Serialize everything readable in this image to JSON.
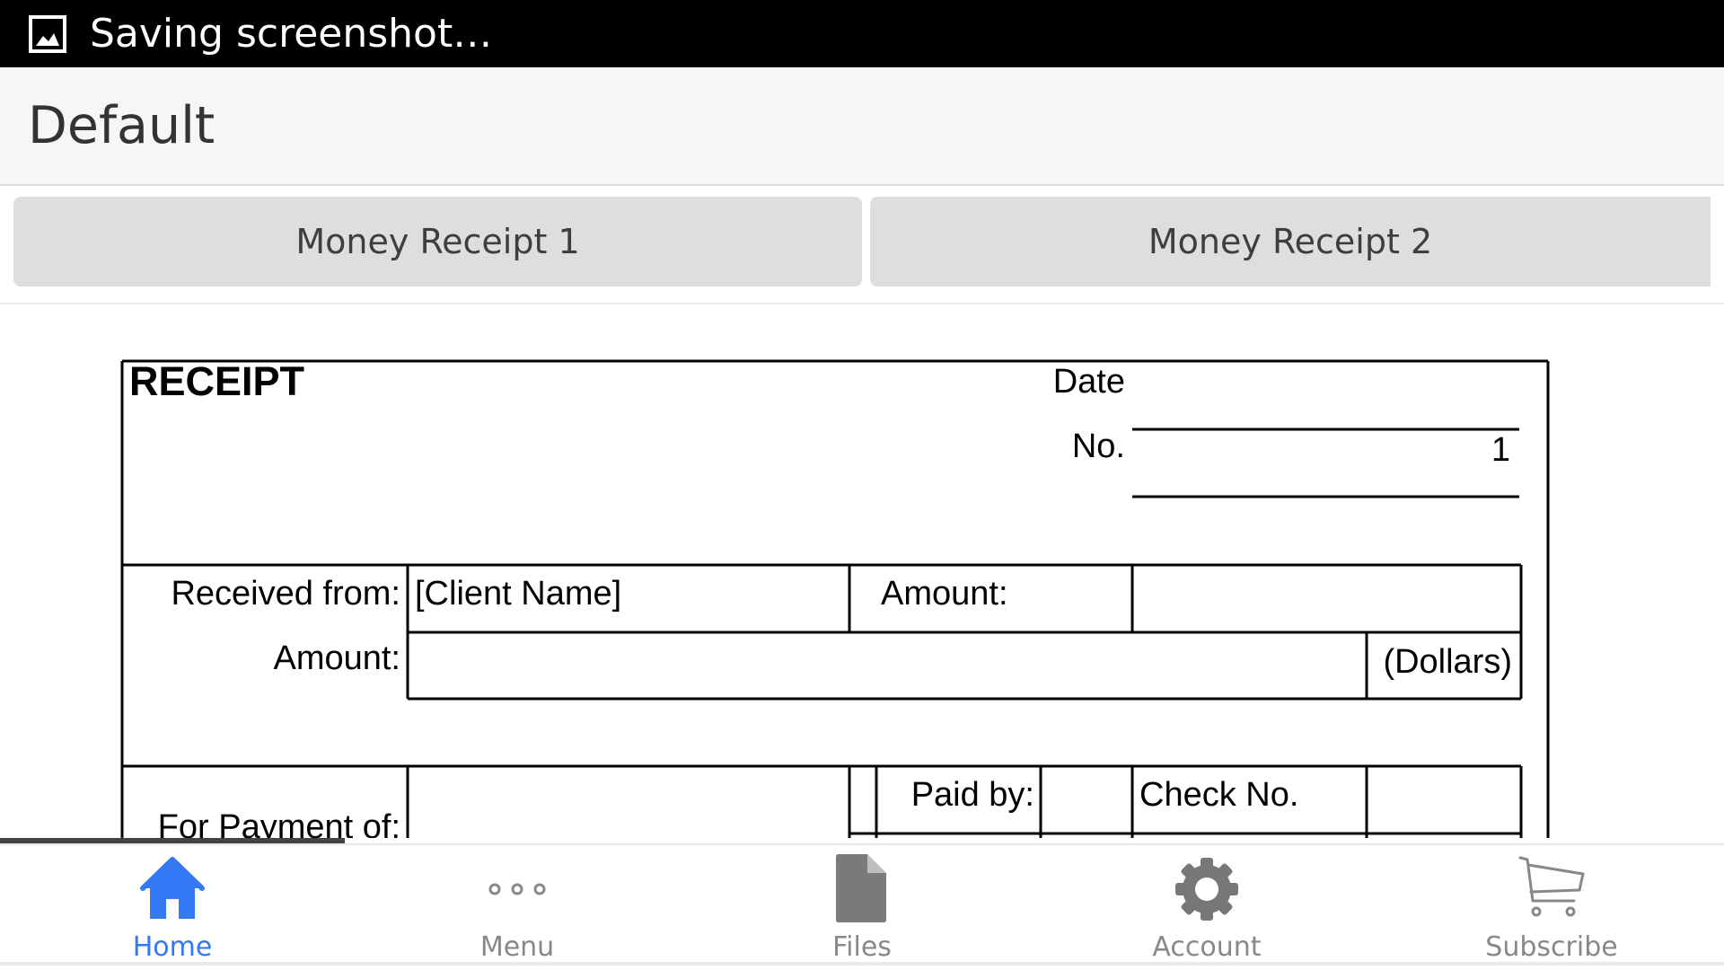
{
  "status_bar": {
    "text": "Saving screenshot…",
    "icon": "image-icon"
  },
  "header": {
    "title": "Default"
  },
  "tabs": [
    {
      "label": "Money Receipt 1"
    },
    {
      "label": "Money Receipt 2"
    }
  ],
  "receipt": {
    "title": "RECEIPT",
    "date_label": "Date",
    "date_value": "",
    "no_label": "No.",
    "no_value": "1",
    "received_from_label": "Received from:",
    "client_name": "[Client Name]",
    "amount_label_right": "Amount:",
    "amount_value_right": "",
    "amount_label_left": "Amount:",
    "amount_words": "",
    "dollars_label": "(Dollars)",
    "for_payment_label": "For Payment of:",
    "paid_by_label": "Paid by:",
    "check_no_label": "Check No."
  },
  "nav": {
    "items": [
      {
        "label": "Home",
        "icon": "home-icon",
        "active": true
      },
      {
        "label": "Menu",
        "icon": "more-dots-icon"
      },
      {
        "label": "Files",
        "icon": "file-icon"
      },
      {
        "label": "Account",
        "icon": "gear-icon"
      },
      {
        "label": "Subscribe",
        "icon": "cart-icon"
      }
    ],
    "active_color": "#3478f6",
    "inactive_color": "#888888"
  }
}
